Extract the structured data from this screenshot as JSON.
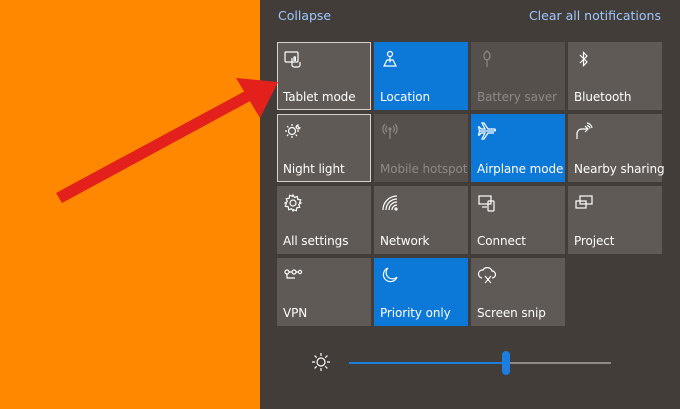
{
  "header": {
    "collapse_label": "Collapse",
    "clear_label": "Clear all notifications"
  },
  "tiles": [
    {
      "label": "Tablet mode",
      "icon": "tablet-mode-icon",
      "state": "off"
    },
    {
      "label": "Location",
      "icon": "location-icon",
      "state": "on"
    },
    {
      "label": "Battery saver",
      "icon": "battery-saver-icon",
      "state": "disabled"
    },
    {
      "label": "Bluetooth",
      "icon": "bluetooth-icon",
      "state": "off"
    },
    {
      "label": "Night light",
      "icon": "night-light-icon",
      "state": "off"
    },
    {
      "label": "Mobile hotspot",
      "icon": "mobile-hotspot-icon",
      "state": "disabled"
    },
    {
      "label": "Airplane mode",
      "icon": "airplane-icon",
      "state": "on"
    },
    {
      "label": "Nearby sharing",
      "icon": "nearby-sharing-icon",
      "state": "off"
    },
    {
      "label": "All settings",
      "icon": "gear-icon",
      "state": "off"
    },
    {
      "label": "Network",
      "icon": "network-icon",
      "state": "off"
    },
    {
      "label": "Connect",
      "icon": "connect-icon",
      "state": "off"
    },
    {
      "label": "Project",
      "icon": "project-icon",
      "state": "off"
    },
    {
      "label": "VPN",
      "icon": "vpn-icon",
      "state": "off"
    },
    {
      "label": "Priority only",
      "icon": "moon-icon",
      "state": "on"
    },
    {
      "label": "Screen snip",
      "icon": "screen-snip-icon",
      "state": "off"
    }
  ],
  "brightness": {
    "icon": "sun-icon",
    "level": 0.6
  },
  "colors": {
    "background_left": "#ff8800",
    "panel": "#433d39",
    "tile_off": "#5f5a56",
    "tile_on": "#0c78d8",
    "link": "#9ec7ff",
    "arrow": "#e3201b"
  }
}
